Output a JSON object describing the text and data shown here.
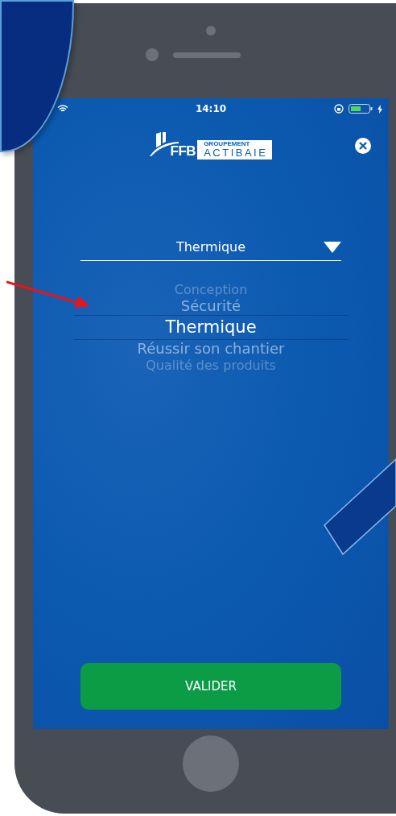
{
  "status_bar": {
    "time": "14:10"
  },
  "logo": {
    "mark": "FFB",
    "tagline": "GROUPEMENT",
    "name": "ACTIBAIE"
  },
  "dropdown": {
    "value": "Thermique"
  },
  "picker": {
    "options": [
      {
        "label": "Conception",
        "selected": false
      },
      {
        "label": "Sécurité",
        "selected": false
      },
      {
        "label": "Thermique",
        "selected": true
      },
      {
        "label": "Réussir son chantier",
        "selected": false
      },
      {
        "label": "Qualité des produits",
        "selected": false
      }
    ]
  },
  "button": {
    "label": "VALIDER"
  }
}
